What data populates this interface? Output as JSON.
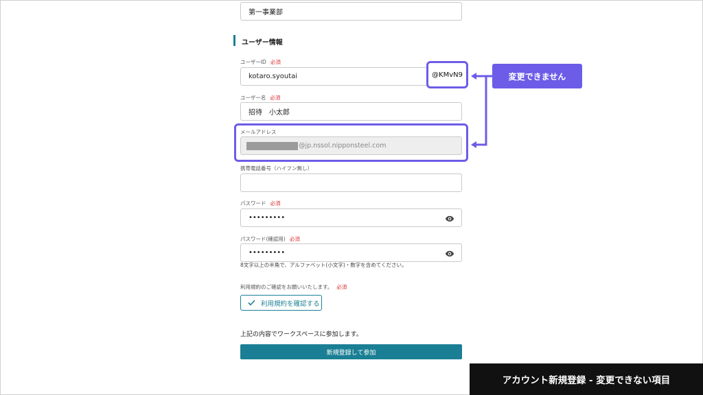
{
  "department": {
    "value": "第一事業部"
  },
  "section": {
    "title": "ユーザー情報"
  },
  "user_id": {
    "label": "ユーザーID",
    "required": "必須",
    "value": "kotaro.syoutai",
    "suffix": "@KMvN9"
  },
  "user_name": {
    "label": "ユーザー名",
    "required": "必須",
    "value": "招待　小太郎"
  },
  "email": {
    "label": "メールアドレス",
    "domain": "@jp.nssol.nipponsteel.com"
  },
  "phone": {
    "label": "携帯電話番号（ハイフン無し）",
    "value": ""
  },
  "password": {
    "label": "パスワード",
    "required": "必須",
    "value": "•••••••••"
  },
  "password_confirm": {
    "label": "パスワード(確認用)",
    "required": "必須",
    "value": "•••••••••",
    "hint": "8文字以上の半角で、アルファベット(小文字)・数字を含めてください。"
  },
  "terms": {
    "label": "利用規約のご確認をお願いいたします。",
    "required": "必須",
    "button_label": "利用規約を確認する"
  },
  "join": {
    "text": "上記の内容でワークスペースに参加します。",
    "submit_label": "新規登録して参加"
  },
  "annotation": {
    "callout": "変更できません",
    "caption": "アカウント新規登録 - 変更できない項目"
  },
  "colors": {
    "accent": "#1a7f95",
    "highlight": "#6c5ce7",
    "required": "#dd3333"
  },
  "icons": {
    "eye": "eye-icon",
    "check": "check-icon"
  }
}
